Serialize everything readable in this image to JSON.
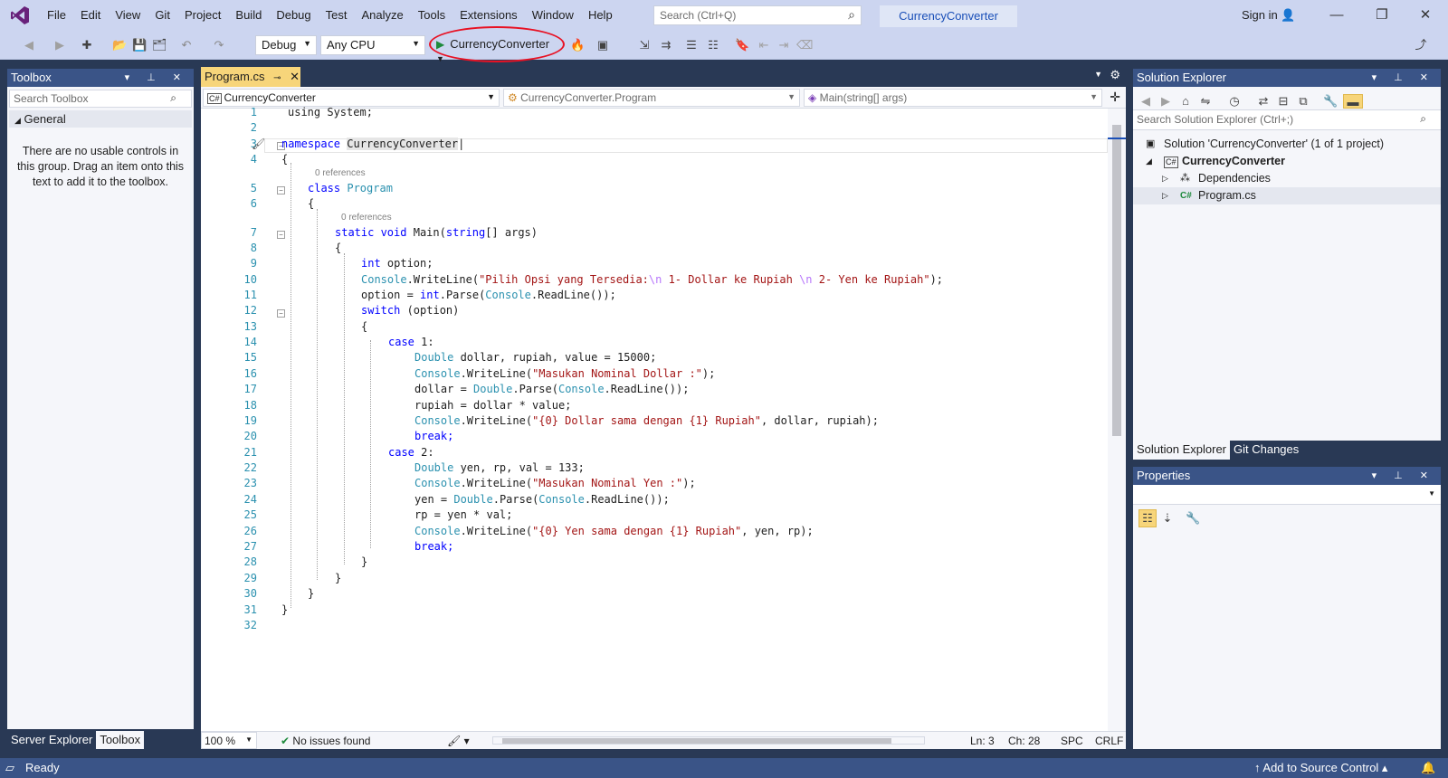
{
  "menu": [
    "File",
    "Edit",
    "View",
    "Git",
    "Project",
    "Build",
    "Debug",
    "Test",
    "Analyze",
    "Tools",
    "Extensions",
    "Window",
    "Help"
  ],
  "search": {
    "placeholder": "Search (Ctrl+Q)"
  },
  "project_name": "CurrencyConverter",
  "signin": "Sign in",
  "toolbar": {
    "config": "Debug",
    "platform": "Any CPU",
    "run_label": "CurrencyConverter"
  },
  "toolbox": {
    "title": "Toolbox",
    "search_placeholder": "Search Toolbox",
    "group": "General",
    "empty_message": "There are no usable controls in this group. Drag an item onto this text to add it to the toolbox.",
    "tabs": [
      "Server Explorer",
      "Toolbox"
    ]
  },
  "editor": {
    "tab_label": "Program.cs",
    "nav_project": "CurrencyConverter",
    "nav_class": "CurrencyConverter.Program",
    "nav_member": "Main(string[] args)",
    "references_label": "0 references",
    "line_numbers": [
      "1",
      "2",
      "3",
      "4",
      "5",
      "6",
      "7",
      "8",
      "9",
      "10",
      "11",
      "12",
      "13",
      "14",
      "15",
      "16",
      "17",
      "18",
      "19",
      "20",
      "21",
      "22",
      "23",
      "24",
      "25",
      "26",
      "27",
      "28",
      "29",
      "30",
      "31",
      "32"
    ]
  },
  "code": {
    "l1": "using System;",
    "l3a": "namespace",
    "l3b": "CurrencyConverter",
    "l4": "{",
    "l5a": "class",
    "l5b": "Program",
    "l6": "{",
    "l7a": "static void",
    "l7b": "Main(",
    "l7c": "string",
    "l7d": "[] args)",
    "l8": "{",
    "l9a": "int",
    "l9b": " option;",
    "l10a": "Console",
    "l10b": ".WriteLine(",
    "l10c": "\"Pilih Opsi yang Tersedia:",
    "l10d": "\\n",
    "l10e": " 1- Dollar ke Rupiah ",
    "l10f": "\\n",
    "l10g": " 2- Yen ke Rupiah\"",
    "l10h": ");",
    "l11a": "option = ",
    "l11b": "int",
    "l11c": ".Parse(",
    "l11d": "Console",
    "l11e": ".ReadLine());",
    "l12a": "switch",
    "l12b": " (option)",
    "l13": "{",
    "l14a": "case",
    "l14b": " 1:",
    "l15a": "Double",
    "l15b": " dollar, rupiah, value = 15000;",
    "l16a": "Console",
    "l16b": ".WriteLine(",
    "l16c": "\"Masukan Nominal Dollar :\"",
    "l16d": ");",
    "l17a": "dollar = ",
    "l17b": "Double",
    "l17c": ".Parse(",
    "l17d": "Console",
    "l17e": ".ReadLine());",
    "l18": "rupiah = dollar * value;",
    "l19a": "Console",
    "l19b": ".WriteLine(",
    "l19c": "\"{0} Dollar sama dengan {1} Rupiah\"",
    "l19d": ", dollar, rupiah);",
    "l20": "break;",
    "l21a": "case",
    "l21b": " 2:",
    "l22a": "Double",
    "l22b": " yen, rp, val = 133;",
    "l23a": "Console",
    "l23b": ".WriteLine(",
    "l23c": "\"Masukan Nominal Yen :\"",
    "l23d": ");",
    "l24a": "yen = ",
    "l24b": "Double",
    "l24c": ".Parse(",
    "l24d": "Console",
    "l24e": ".ReadLine());",
    "l25": "rp = yen * val;",
    "l26a": "Console",
    "l26b": ".WriteLine(",
    "l26c": "\"{0} Yen sama dengan {1} Rupiah\"",
    "l26d": ", yen, rp);",
    "l27": "break;",
    "l28": "}",
    "l29": "}",
    "l30": "}",
    "l31": "}"
  },
  "editor_status": {
    "zoom": "100 %",
    "issues": "No issues found",
    "line": "Ln: 3",
    "col": "Ch: 28",
    "spc": "SPC",
    "eol": "CRLF"
  },
  "solution_explorer": {
    "title": "Solution Explorer",
    "search_placeholder": "Search Solution Explorer (Ctrl+;)",
    "solution": "Solution 'CurrencyConverter' (1 of 1 project)",
    "project": "CurrencyConverter",
    "dependencies": "Dependencies",
    "file": "Program.cs",
    "tabs": [
      "Solution Explorer",
      "Git Changes"
    ]
  },
  "properties": {
    "title": "Properties"
  },
  "status": {
    "ready": "Ready",
    "source_control": "Add to Source Control"
  }
}
